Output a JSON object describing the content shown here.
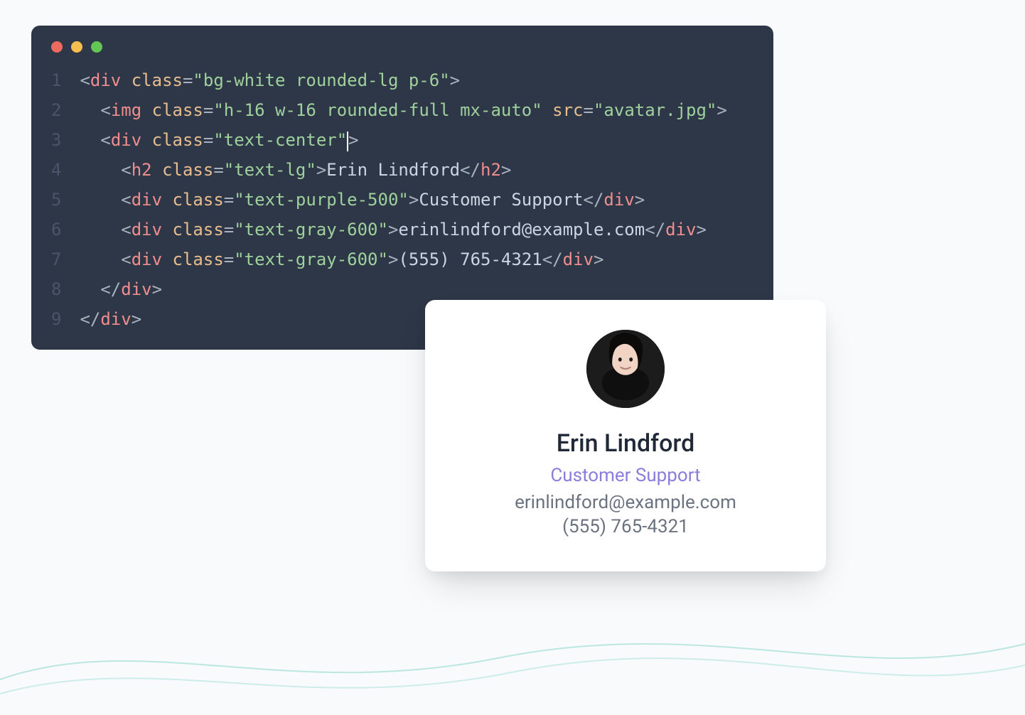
{
  "editor": {
    "line_numbers": [
      "1",
      "2",
      "3",
      "4",
      "5",
      "6",
      "7",
      "8",
      "9"
    ],
    "code": [
      [
        {
          "c": "t-punc",
          "t": "<"
        },
        {
          "c": "t-tag",
          "t": "div"
        },
        {
          "c": "",
          "t": " "
        },
        {
          "c": "t-attr",
          "t": "class"
        },
        {
          "c": "t-punc",
          "t": "="
        },
        {
          "c": "t-str",
          "t": "\"bg-white rounded-lg p-6\""
        },
        {
          "c": "t-punc",
          "t": ">"
        }
      ],
      [
        {
          "c": "",
          "t": "  "
        },
        {
          "c": "t-punc",
          "t": "<"
        },
        {
          "c": "t-tag",
          "t": "img"
        },
        {
          "c": "",
          "t": " "
        },
        {
          "c": "t-attr",
          "t": "class"
        },
        {
          "c": "t-punc",
          "t": "="
        },
        {
          "c": "t-str",
          "t": "\"h-16 w-16 rounded-full mx-auto\""
        },
        {
          "c": "",
          "t": " "
        },
        {
          "c": "t-attr",
          "t": "src"
        },
        {
          "c": "t-punc",
          "t": "="
        },
        {
          "c": "t-str",
          "t": "\"avatar.jpg\""
        },
        {
          "c": "t-punc",
          "t": ">"
        }
      ],
      [
        {
          "c": "",
          "t": "  "
        },
        {
          "c": "t-punc",
          "t": "<"
        },
        {
          "c": "t-tag",
          "t": "div"
        },
        {
          "c": "",
          "t": " "
        },
        {
          "c": "t-attr",
          "t": "class"
        },
        {
          "c": "t-punc",
          "t": "="
        },
        {
          "c": "t-str",
          "t": "\"text-center\""
        },
        {
          "c": "cursor",
          "t": ""
        },
        {
          "c": "t-punc",
          "t": ">"
        }
      ],
      [
        {
          "c": "",
          "t": "    "
        },
        {
          "c": "t-punc",
          "t": "<"
        },
        {
          "c": "t-tag",
          "t": "h2"
        },
        {
          "c": "",
          "t": " "
        },
        {
          "c": "t-attr",
          "t": "class"
        },
        {
          "c": "t-punc",
          "t": "="
        },
        {
          "c": "t-str",
          "t": "\"text-lg\""
        },
        {
          "c": "t-punc",
          "t": ">"
        },
        {
          "c": "",
          "t": "Erin Lindford"
        },
        {
          "c": "t-punc",
          "t": "</"
        },
        {
          "c": "t-tag",
          "t": "h2"
        },
        {
          "c": "t-punc",
          "t": ">"
        }
      ],
      [
        {
          "c": "",
          "t": "    "
        },
        {
          "c": "t-punc",
          "t": "<"
        },
        {
          "c": "t-tag",
          "t": "div"
        },
        {
          "c": "",
          "t": " "
        },
        {
          "c": "t-attr",
          "t": "class"
        },
        {
          "c": "t-punc",
          "t": "="
        },
        {
          "c": "t-str",
          "t": "\"text-purple-500\""
        },
        {
          "c": "t-punc",
          "t": ">"
        },
        {
          "c": "",
          "t": "Customer Support"
        },
        {
          "c": "t-punc",
          "t": "</"
        },
        {
          "c": "t-tag",
          "t": "div"
        },
        {
          "c": "t-punc",
          "t": ">"
        }
      ],
      [
        {
          "c": "",
          "t": "    "
        },
        {
          "c": "t-punc",
          "t": "<"
        },
        {
          "c": "t-tag",
          "t": "div"
        },
        {
          "c": "",
          "t": " "
        },
        {
          "c": "t-attr",
          "t": "class"
        },
        {
          "c": "t-punc",
          "t": "="
        },
        {
          "c": "t-str",
          "t": "\"text-gray-600\""
        },
        {
          "c": "t-punc",
          "t": ">"
        },
        {
          "c": "",
          "t": "erinlindford@example.com"
        },
        {
          "c": "t-punc",
          "t": "</"
        },
        {
          "c": "t-tag",
          "t": "div"
        },
        {
          "c": "t-punc",
          "t": ">"
        }
      ],
      [
        {
          "c": "",
          "t": "    "
        },
        {
          "c": "t-punc",
          "t": "<"
        },
        {
          "c": "t-tag",
          "t": "div"
        },
        {
          "c": "",
          "t": " "
        },
        {
          "c": "t-attr",
          "t": "class"
        },
        {
          "c": "t-punc",
          "t": "="
        },
        {
          "c": "t-str",
          "t": "\"text-gray-600\""
        },
        {
          "c": "t-punc",
          "t": ">"
        },
        {
          "c": "",
          "t": "(555) 765-4321"
        },
        {
          "c": "t-punc",
          "t": "</"
        },
        {
          "c": "t-tag",
          "t": "div"
        },
        {
          "c": "t-punc",
          "t": ">"
        }
      ],
      [
        {
          "c": "",
          "t": "  "
        },
        {
          "c": "t-punc",
          "t": "</"
        },
        {
          "c": "t-tag",
          "t": "div"
        },
        {
          "c": "t-punc",
          "t": ">"
        }
      ],
      [
        {
          "c": "t-punc",
          "t": "</"
        },
        {
          "c": "t-tag",
          "t": "div"
        },
        {
          "c": "t-punc",
          "t": ">"
        }
      ]
    ]
  },
  "card": {
    "name": "Erin Lindford",
    "role": "Customer Support",
    "email": "erinlindford@example.com",
    "phone": "(555) 765-4321"
  }
}
